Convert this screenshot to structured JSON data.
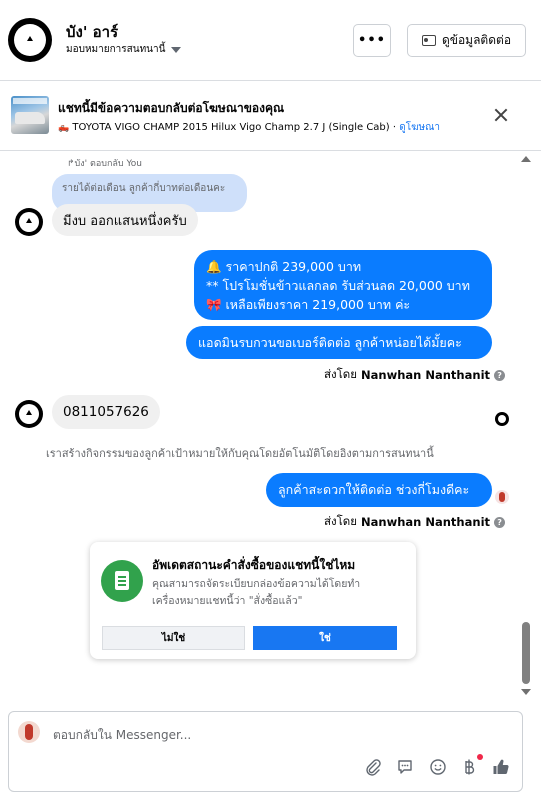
{
  "header": {
    "name": "บัง' อาร์",
    "assign_label": "มอบหมายการสนทนานี้",
    "more_label": "•••",
    "contact_label": "ดูข้อมูลติดต่อ"
  },
  "ad": {
    "title": "แชทนี้มีข้อความตอบกลับต่อโฆษณาของคุณ",
    "description": "TOYOTA VIGO CHAMP 2015 Hilux Vigo Champ 2.7 J (Single Cab)",
    "separator": " ⋅ ",
    "link": "ดูโฆษณา"
  },
  "messages": {
    "reply_hint": "↱บัง' ตอบกลับ You",
    "quoted_text": "รายได้ต่อเดือน ลูกค้ากี่บาทต่อเดือนคะ",
    "in_1": "มีงบ ออกแสนหนึ่งครับ",
    "out_1_line1": "🔔 ราคาปกติ 239,000 บาท",
    "out_1_line2": "** โปรโมชั่นข้าวแลกลด รับส่วนลด 20,000 บาท",
    "out_1_line3": "🎀  เหลือเพียงราคา 219,000 บาท ค่ะ",
    "out_2": "แอดมินรบกวนขอเบอร์ติดต่อ ลูกค้าหน่อยได้มั้ยคะ",
    "sent_by_1_prefix": "ส่งโดย",
    "sent_by_1_name": "Nanwhan Nanthanit",
    "in_2": "0811057626",
    "system_note": "เราสร้างกิจกรรมของลูกค้าเป้าหมายให้กับคุณโดยอัตโนมัติโดยอิงตามการสนทนานี้",
    "out_3": "ลูกค้าสะดวกให้ติดต่อ ช่วงกี่โมงดีคะ",
    "sent_by_2_prefix": "ส่งโดย",
    "sent_by_2_name": "Nanwhan Nanthanit"
  },
  "order_card": {
    "title": "อัพเดตสถานะคำสั่งซื้อของแชทนี้ใช่ไหม",
    "body": "คุณสามารถจัดระเบียบกล่องข้อความได้โดยทำเครื่องหมายแชทนี้ว่า \"สั่งซื้อแล้ว\"",
    "no_label": "ไม่ใช่",
    "yes_label": "ใช่"
  },
  "composer": {
    "placeholder": "ตอบกลับใน Messenger..."
  },
  "colors": {
    "accent": "#1877f2",
    "outgoing_bubble": "#0a7cff",
    "incoming_bubble": "#f0f0f0",
    "quoted_bubble": "#cfe0fa",
    "order_icon": "#31a24c"
  },
  "icons": [
    "avatar",
    "chevron-down-icon",
    "more-icon",
    "contact-card-icon",
    "close-icon",
    "attachment-icon",
    "saved-reply-icon",
    "emoji-icon",
    "baht-icon",
    "thumbs-up-icon",
    "order-doc-icon",
    "info-icon"
  ]
}
